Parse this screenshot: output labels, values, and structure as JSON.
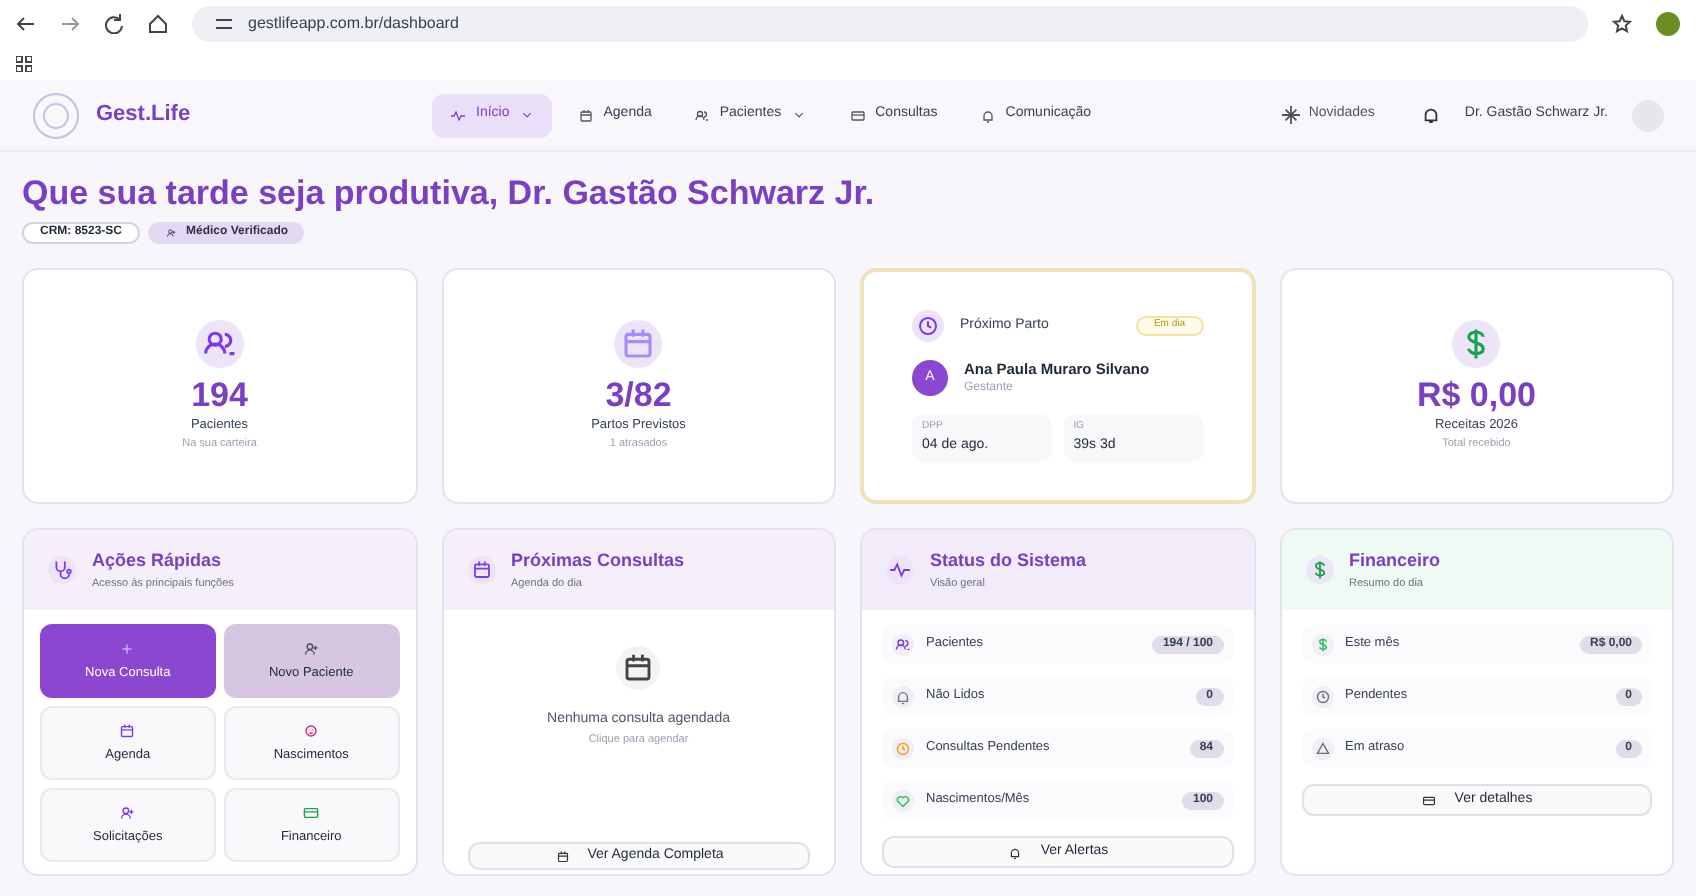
{
  "browser": {
    "url": "gestlifeapp.com.br/dashboard"
  },
  "brand": {
    "name": "Gest.Life"
  },
  "nav": [
    {
      "label": "Início",
      "selected": true,
      "dropdown": true
    },
    {
      "label": "Agenda",
      "selected": false,
      "dropdown": false
    },
    {
      "label": "Pacientes",
      "selected": false,
      "dropdown": true
    },
    {
      "label": "Consultas",
      "selected": false,
      "dropdown": false
    },
    {
      "label": "Comunicação",
      "selected": false,
      "dropdown": false
    }
  ],
  "header_right": {
    "news": "Novidades",
    "user": "Dr. Gastão Schwarz Jr."
  },
  "greeting": "Que sua tarde seja produtiva, Dr. Gastão Schwarz Jr.",
  "tags": [
    {
      "label": "CRM: 8523-SC",
      "kind": "plain"
    },
    {
      "label": "Médico Verificado",
      "kind": "verified"
    }
  ],
  "stats": [
    {
      "kind": "stat",
      "value": "194",
      "label": "Pacientes",
      "sub": "Na sua carteira"
    },
    {
      "kind": "stat",
      "value": "3/82",
      "label": "Partos Previstos",
      "sub": "1 atrasados"
    },
    {
      "kind": "birth",
      "title": "Próximo Parto",
      "badge": "Em dia",
      "initial": "A",
      "name": "Ana Paula Muraro Silvano",
      "role": "Gestante",
      "fields": [
        {
          "label": "DPP",
          "value": "04 de ago."
        },
        {
          "label": "IG",
          "value": "39s 3d"
        }
      ]
    },
    {
      "kind": "stat",
      "value": "R$ 0,00",
      "label": "Receitas 2026",
      "sub": "Total recebido"
    }
  ],
  "quick_actions": {
    "title": "Ações Rápidas",
    "subtitle": "Acesso às principais funções",
    "items": [
      {
        "label": "Nova Consulta",
        "kind": "primary"
      },
      {
        "label": "Novo Paciente",
        "kind": "secondary"
      },
      {
        "label": "Agenda",
        "kind": "plain"
      },
      {
        "label": "Nascimentos",
        "kind": "plain"
      },
      {
        "label": "Solicitações",
        "kind": "plain"
      },
      {
        "label": "Financeiro",
        "kind": "plain"
      }
    ]
  },
  "upcoming": {
    "title": "Próximas Consultas",
    "subtitle": "Agenda do dia",
    "empty": "Nenhuma consulta agendada",
    "hint": "Clique para agendar",
    "button": "Ver Agenda Completa"
  },
  "system": {
    "title": "Status do Sistema",
    "subtitle": "Visão geral",
    "rows": [
      {
        "label": "Pacientes",
        "value": "194 / 100"
      },
      {
        "label": "Não Lidos",
        "value": "0"
      },
      {
        "label": "Consultas Pendentes",
        "value": "84"
      },
      {
        "label": "Nascimentos/Mês",
        "value": "100"
      }
    ],
    "button": "Ver Alertas"
  },
  "finance": {
    "title": "Financeiro",
    "subtitle": "Resumo do dia",
    "rows": [
      {
        "label": "Este mês",
        "value": "R$ 0,00"
      },
      {
        "label": "Pendentes",
        "value": "0"
      },
      {
        "label": "Em atraso",
        "value": "0"
      }
    ],
    "button": "Ver detalhes"
  }
}
